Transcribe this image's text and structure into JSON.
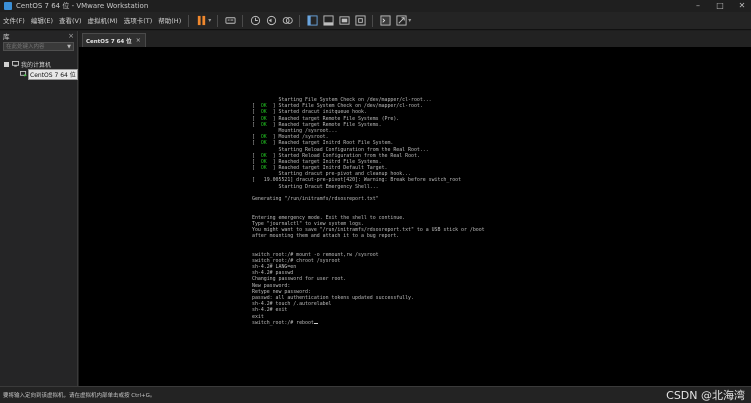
{
  "window": {
    "title": "CentOS 7 64 位 - VMware Workstation",
    "controls": [
      "–",
      "□",
      "✕"
    ]
  },
  "menu": {
    "items": [
      "文件(F)",
      "编辑(E)",
      "查看(V)",
      "虚拟机(M)",
      "选项卡(T)",
      "帮助(H)"
    ]
  },
  "toolbar": {
    "icons": [
      "pause-icon",
      "send-ctrl-alt-del-icon",
      "snapshot-icon",
      "revert-snapshot-icon",
      "snapshot-manager-icon",
      "library-view-icon",
      "thumbnail-bar-icon",
      "fullscreen-icon",
      "unity-icon",
      "console-view-icon",
      "stretch-icon"
    ],
    "accent": "#f0882d"
  },
  "library": {
    "title": "库",
    "close": "×",
    "search_placeholder": "在此处键入内容",
    "tree": {
      "root_label": "我的计算机",
      "vm_label": "CentOS 7 64 位"
    }
  },
  "tabs": [
    {
      "label": "CentOS 7 64 位",
      "close": "×"
    }
  ],
  "console": {
    "lines": [
      {
        "ok": false,
        "text": "         Starting File System Check on /dev/mapper/cl-root..."
      },
      {
        "ok": true,
        "text": "] Started File System Check on /dev/mapper/cl-root."
      },
      {
        "ok": true,
        "text": "] Started dracut initqueue hook."
      },
      {
        "ok": true,
        "text": "] Reached target Remote File Systems (Pre)."
      },
      {
        "ok": true,
        "text": "] Reached target Remote File Systems."
      },
      {
        "ok": false,
        "text": "         Mounting /sysroot..."
      },
      {
        "ok": true,
        "text": "] Mounted /sysroot."
      },
      {
        "ok": true,
        "text": "] Reached target Initrd Root File System."
      },
      {
        "ok": false,
        "text": "         Starting Reload Configuration from the Real Root..."
      },
      {
        "ok": true,
        "text": "] Started Reload Configuration from the Real Root."
      },
      {
        "ok": true,
        "text": "] Reached target Initrd File Systems."
      },
      {
        "ok": true,
        "text": "] Reached target Initrd Default Target."
      },
      {
        "ok": false,
        "text": "         Starting dracut pre-pivot and cleanup hook..."
      },
      {
        "ok": false,
        "text": "[   19.005521] dracut-pre-pivot[420]: Warning: Break before switch_root"
      },
      {
        "ok": false,
        "text": "         Starting Dracut Emergency Shell..."
      },
      {
        "ok": false,
        "text": ""
      },
      {
        "ok": false,
        "text": "Generating \"/run/initramfs/rdsosreport.txt\""
      },
      {
        "ok": false,
        "text": ""
      },
      {
        "ok": false,
        "text": ""
      },
      {
        "ok": false,
        "text": "Entering emergency mode. Exit the shell to continue."
      },
      {
        "ok": false,
        "text": "Type \"journalctl\" to view system logs."
      },
      {
        "ok": false,
        "text": "You might want to save \"/run/initramfs/rdsosreport.txt\" to a USB stick or /boot"
      },
      {
        "ok": false,
        "text": "after mounting them and attach it to a bug report."
      },
      {
        "ok": false,
        "text": ""
      },
      {
        "ok": false,
        "text": ""
      },
      {
        "ok": false,
        "text": "switch_root:/# mount -o remount,rw /sysroot"
      },
      {
        "ok": false,
        "text": "switch_root:/# chroot /sysroot"
      },
      {
        "ok": false,
        "text": "sh-4.2# LANG=en"
      },
      {
        "ok": false,
        "text": "sh-4.2# passwd"
      },
      {
        "ok": false,
        "text": "Changing password for user root."
      },
      {
        "ok": false,
        "text": "New password:"
      },
      {
        "ok": false,
        "text": "Retype new password:"
      },
      {
        "ok": false,
        "text": "passwd: all authentication tokens updated successfully."
      },
      {
        "ok": false,
        "text": "sh-4.2# touch /.autorelabel"
      },
      {
        "ok": false,
        "text": "sh-4.2# exit"
      },
      {
        "ok": false,
        "text": "exit"
      },
      {
        "ok": false,
        "text": "switch_root:/# reboot"
      }
    ],
    "ok_label": "OK",
    "colors": {
      "background": "#000000",
      "text": "#bdbdbd",
      "ok": "#22c422"
    }
  },
  "statusbar": {
    "text": "要将输入定向到该虚拟机，请在虚拟机内部单击或按 Ctrl+G。",
    "watermark": "CSDN @北海湾"
  }
}
